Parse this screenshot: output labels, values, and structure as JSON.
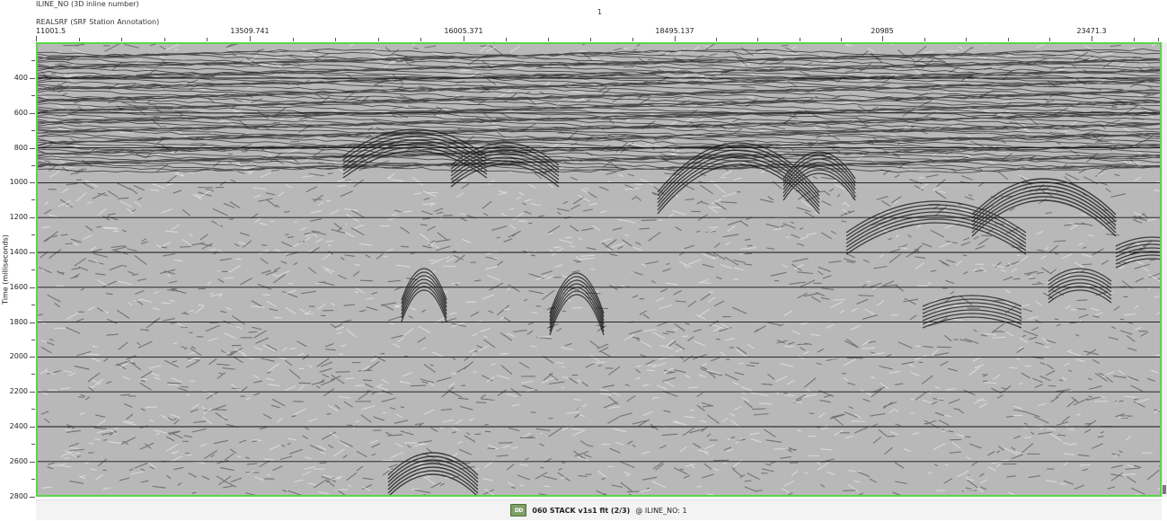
{
  "header": {
    "iline_title": "ILINE_NO (3D inline number)",
    "iline_value": "1",
    "realsrf_title": "REALSRF (SRF Station Annotation)"
  },
  "x_axis": {
    "labels": [
      "11001.5",
      "13509.741",
      "16005.371",
      "18495.137",
      "20985",
      "23471.3"
    ]
  },
  "y_axis": {
    "title": "Time (milliseconds)",
    "labels": [
      "400",
      "600",
      "800",
      "1000",
      "1200",
      "1400",
      "1600",
      "1800",
      "2000",
      "2200",
      "2400",
      "2600",
      "2800"
    ]
  },
  "status_bar": {
    "icon": "dataset-icon",
    "icon_text": "DD",
    "dataset_name": "060 STACK v1s1 flt (2/3)",
    "context": "@  ILINE_NO: 1"
  },
  "colors": {
    "frame_border": "#5bd54a",
    "status_bg": "#f3f3f3"
  }
}
